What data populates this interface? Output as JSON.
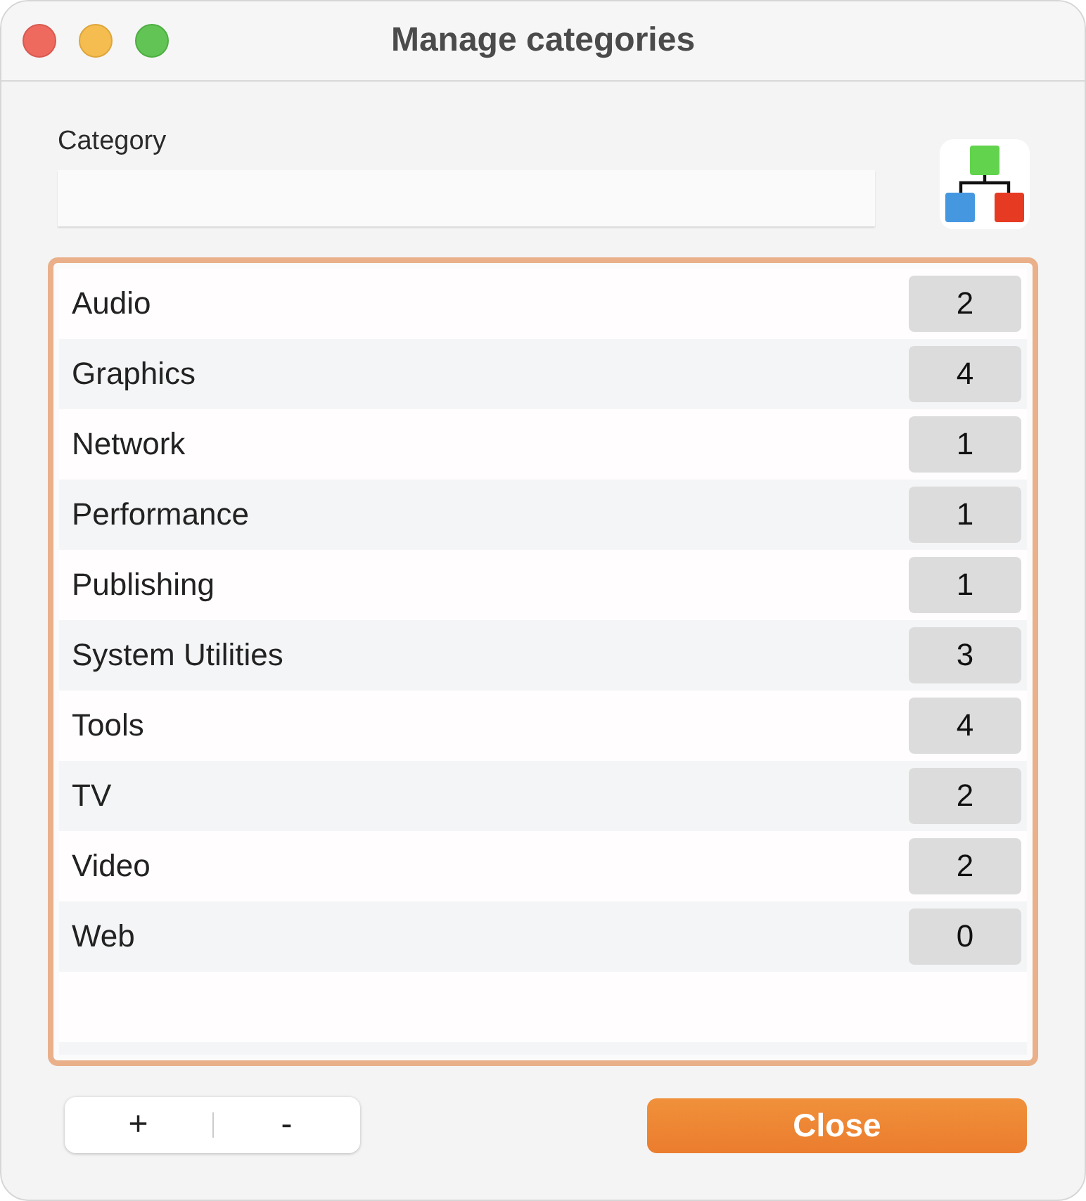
{
  "window": {
    "title": "Manage categories"
  },
  "category_field": {
    "label": "Category"
  },
  "categories": [
    {
      "name": "Audio",
      "count": "2",
      "selected": false
    },
    {
      "name": "Graphics",
      "count": "4",
      "selected": false
    },
    {
      "name": "Network",
      "count": "1",
      "selected": false
    },
    {
      "name": "Performance",
      "count": "1",
      "selected": false
    },
    {
      "name": "Publishing",
      "count": "1",
      "selected": false
    },
    {
      "name": "System Utilities",
      "count": "3",
      "selected": false
    },
    {
      "name": "Tools",
      "count": "4",
      "selected": false
    },
    {
      "name": "TV",
      "count": "2",
      "selected": false
    },
    {
      "name": "Video",
      "count": "2",
      "selected": false
    },
    {
      "name": "Web",
      "count": "0",
      "selected": false
    }
  ],
  "buttons": {
    "add": "+",
    "remove": "-",
    "close": "Close"
  }
}
